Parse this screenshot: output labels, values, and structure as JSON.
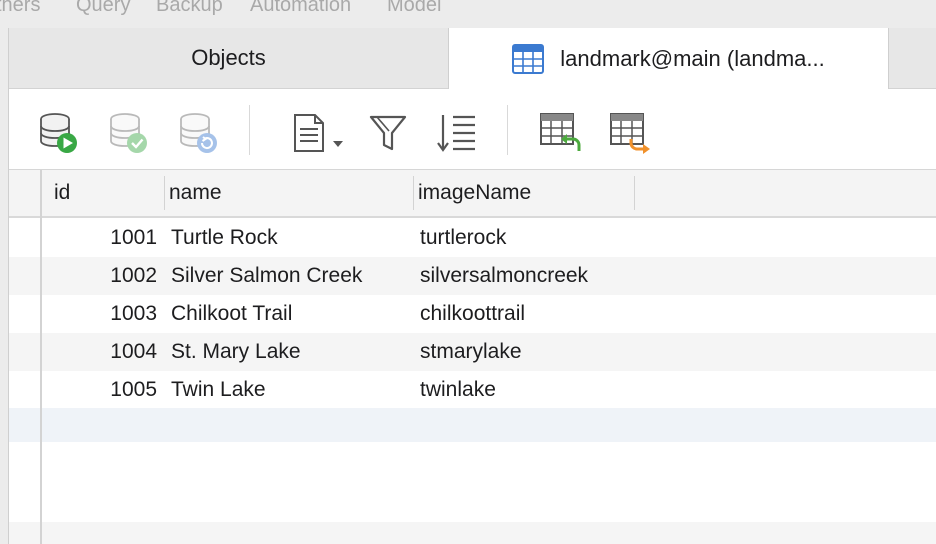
{
  "menubar": {
    "items": [
      "thers",
      "Query",
      "Backup",
      "Automation",
      "Model"
    ]
  },
  "tabs": [
    {
      "label": "Objects",
      "active": false
    },
    {
      "label": "landmark@main (landma...",
      "active": true,
      "icon": "table-icon"
    }
  ],
  "toolbar": {
    "buttons": [
      {
        "name": "run-query-icon",
        "enabled": true
      },
      {
        "name": "commit-icon",
        "enabled": false
      },
      {
        "name": "refresh-icon",
        "enabled": false
      },
      {
        "name": "text-view-icon",
        "enabled": true
      },
      {
        "name": "filter-icon",
        "enabled": true
      },
      {
        "name": "sort-icon",
        "enabled": true
      },
      {
        "name": "import-icon",
        "enabled": true
      },
      {
        "name": "export-icon",
        "enabled": true
      }
    ]
  },
  "grid": {
    "columns": [
      "id",
      "name",
      "imageName"
    ],
    "rows": [
      {
        "id": "1001",
        "name": "Turtle Rock",
        "imageName": "turtlerock"
      },
      {
        "id": "1002",
        "name": "Silver Salmon Creek",
        "imageName": "silversalmoncreek"
      },
      {
        "id": "1003",
        "name": "Chilkoot Trail",
        "imageName": "chilkoottrail"
      },
      {
        "id": "1004",
        "name": "St. Mary Lake",
        "imageName": "stmarylake"
      },
      {
        "id": "1005",
        "name": "Twin Lake",
        "imageName": "twinlake"
      }
    ]
  },
  "colors": {
    "accent": "#3b7ad0",
    "run_green": "#39a845",
    "import_green": "#4caa3e",
    "export_orange": "#f0912c"
  }
}
